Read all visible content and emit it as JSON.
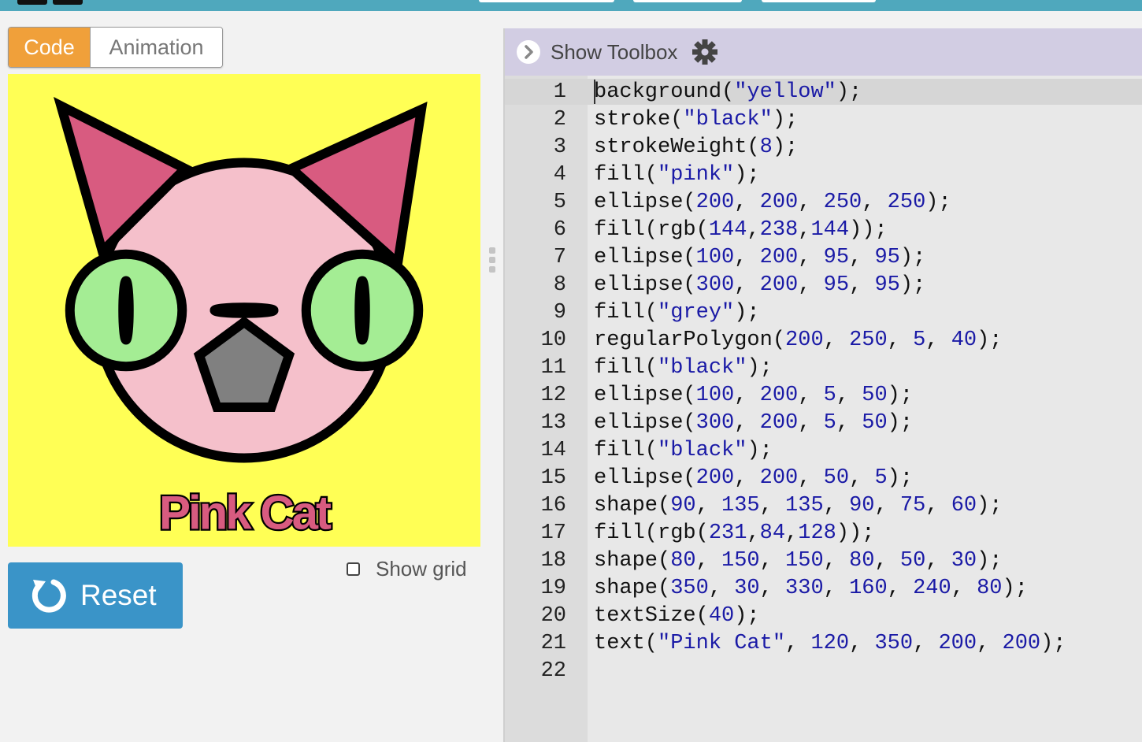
{
  "tabs": {
    "code": "Code",
    "animation": "Animation"
  },
  "canvas": {
    "text": "Pink Cat",
    "background": "#ffff55",
    "face_fill": "#f5c0cb",
    "eye_fill": "#a4ed94",
    "ear_fill": "#d85b80",
    "nose_fill": "#808080"
  },
  "controls": {
    "reset_label": "Reset",
    "show_grid_label": "Show grid"
  },
  "editor": {
    "toolbox_label": "Show Toolbox",
    "lines": [
      "background(\"yellow\");",
      "stroke(\"black\");",
      "strokeWeight(8);",
      "fill(\"pink\");",
      "ellipse(200, 200, 250, 250);",
      "fill(rgb(144,238,144));",
      "ellipse(100, 200, 95, 95);",
      "ellipse(300, 200, 95, 95);",
      "fill(\"grey\");",
      "regularPolygon(200, 250, 5, 40);",
      "fill(\"black\");",
      "ellipse(100, 200, 5, 50);",
      "ellipse(300, 200, 5, 50);",
      "fill(\"black\");",
      "ellipse(200, 200, 50, 5);",
      "shape(90, 135, 135, 90, 75, 60);",
      "fill(rgb(231,84,128));",
      "shape(80, 150, 150, 80, 50, 30);",
      "shape(350, 30, 330, 160, 240, 80);",
      "textSize(40);",
      "text(\"Pink Cat\", 120, 350, 200, 200);",
      ""
    ]
  },
  "colors": {
    "accent_orange": "#f0a03a",
    "reset_blue": "#3a94c8",
    "toolbar_purple": "#d2cde3",
    "top_bar": "#4fa8bd"
  }
}
